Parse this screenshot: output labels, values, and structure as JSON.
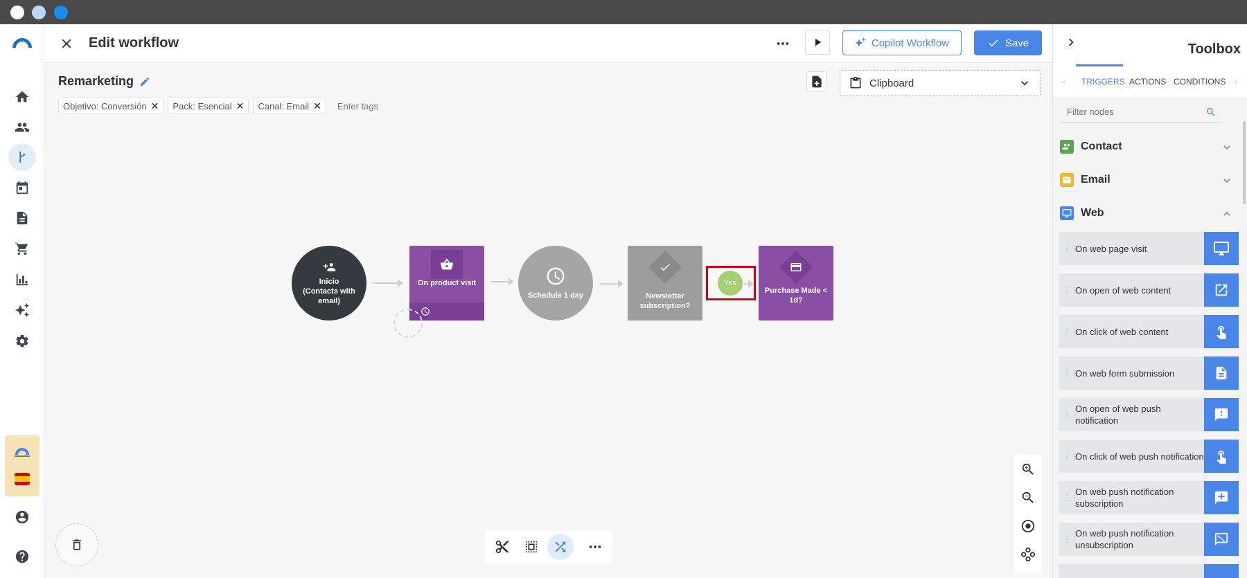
{
  "colors": {
    "accent": "#4a86e8",
    "start_node": "#343a40",
    "trigger_node": "#8a4fa4",
    "delay_node": "#a5a5a5",
    "condition_node": "#9d9d9d",
    "yes_pill": "#a6cf6f",
    "highlight_box": "#d0021b"
  },
  "header": {
    "title": "Edit workflow",
    "copilot_label": "Copilot Workflow",
    "save_label": "Save"
  },
  "workflow": {
    "name": "Remarketing",
    "tags": [
      {
        "label": "Objetivo: Conversión"
      },
      {
        "label": "Pack: Esencial"
      },
      {
        "label": "Canal: Email"
      }
    ],
    "tags_placeholder": "Enter tags",
    "clipboard_label": "Clipboard",
    "nodes": {
      "start": "Inicio (Contacts with email)",
      "product_visit": "On product visit",
      "schedule": "Schedule 1 day",
      "newsletter": "Newsletter subscription?",
      "yes": "Yes",
      "purchase": "Purchase Made < 1d?"
    }
  },
  "toolbox": {
    "title": "Toolbox",
    "tabs": [
      "TRIGGERS",
      "ACTIONS",
      "CONDITIONS"
    ],
    "active_tab": "TRIGGERS",
    "filter_placeholder": "Filter nodes",
    "categories": [
      {
        "name": "Contact",
        "icon": "contacts-icon",
        "color": "#5aa454"
      },
      {
        "name": "Email",
        "icon": "email-icon",
        "color": "#f2b632"
      },
      {
        "name": "Web",
        "icon": "monitor-icon",
        "color": "#4a86e8"
      }
    ],
    "web_items": [
      {
        "label": "On web page visit",
        "icon": "monitor-icon"
      },
      {
        "label": "On open of web content",
        "icon": "open-external-icon"
      },
      {
        "label": "On click of web content",
        "icon": "touch-icon"
      },
      {
        "label": "On web form submission",
        "icon": "document-icon"
      },
      {
        "label": "On open of web push notification",
        "icon": "notification-icon"
      },
      {
        "label": "On click of web push notification",
        "icon": "touch-icon"
      },
      {
        "label": "On web push notification subscription",
        "icon": "add-comment-icon"
      },
      {
        "label": "On web push notification unsubscription",
        "icon": "comment-off-icon"
      }
    ]
  }
}
